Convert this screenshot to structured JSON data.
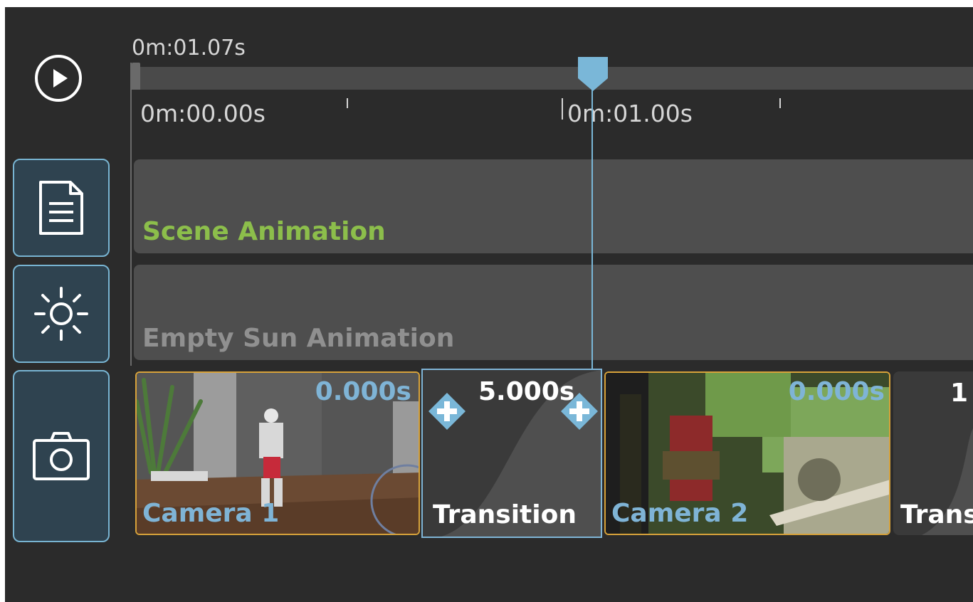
{
  "timeline": {
    "current_time": "0m:01.07s",
    "ruler_labels": [
      "0m:00.00s",
      "0m:01.00s"
    ]
  },
  "tracks": [
    {
      "label": "Scene Animation",
      "color": "#8cbe4b"
    },
    {
      "label": "Empty Sun Animation",
      "color": "#909090"
    }
  ],
  "clips": {
    "camera1": {
      "name": "Camera 1",
      "duration": "0.000s"
    },
    "transition1": {
      "name": "Transition",
      "duration": "5.000s"
    },
    "camera2": {
      "name": "Camera 2",
      "duration": "0.000s"
    },
    "transition2": {
      "name": "Transition",
      "duration": "1"
    }
  },
  "sidebar": {
    "buttons": [
      {
        "icon": "document-icon"
      },
      {
        "icon": "sun-icon"
      },
      {
        "icon": "camera-icon"
      }
    ]
  },
  "colors": {
    "accent": "#7ab7d8",
    "camera_clip_border": "#d7a23a",
    "background": "#2b2b2b"
  }
}
